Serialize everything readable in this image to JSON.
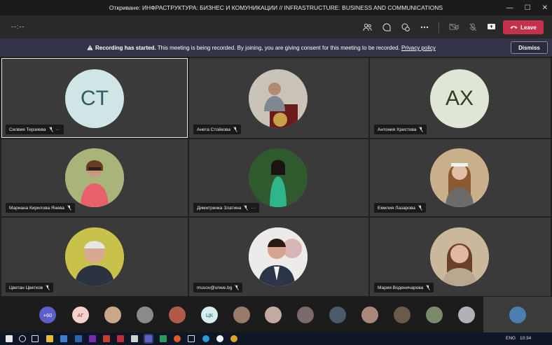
{
  "window": {
    "title": "Откриване: ИНФРАСТРУКТУРА: БИЗНЕС И КОМУНИКАЦИИ // INFRASTRUCTURE: BUSINESS AND COMMUNICATIONS"
  },
  "toolbar": {
    "timer": "--:--",
    "leave_label": "Leave"
  },
  "banner": {
    "bold": "Recording has started.",
    "text": " This meeting is being recorded. By joining, you are giving consent for this meeting to be recorded.",
    "link": "Privacy policy",
    "dismiss_label": "Dismiss"
  },
  "participants": [
    {
      "name": "Силвия Терзиева",
      "initials": "CT",
      "avatar_color": "#cfe5e6",
      "more": "···"
    },
    {
      "name": "Анета Стойкова",
      "initials": "",
      "avatar_color": "#6b5a52",
      "more": ""
    },
    {
      "name": "Антония Христова",
      "initials": "AX",
      "avatar_color": "#dfe6d6",
      "more": ""
    },
    {
      "name": "Мариана Кирилова Янева",
      "initials": "",
      "avatar_color": "#d4c9a4",
      "more": ""
    },
    {
      "name": "Димитринка Златина",
      "initials": "",
      "avatar_color": "#3f6a3a",
      "more": "···"
    },
    {
      "name": "Емилия Лазарова",
      "initials": "",
      "avatar_color": "#8c6a52",
      "more": ""
    },
    {
      "name": "Цветан Цветков",
      "initials": "",
      "avatar_color": "#c9c24a",
      "more": ""
    },
    {
      "name": "musov@unwe.bg",
      "initials": "",
      "avatar_color": "#e6e2df",
      "more": ""
    },
    {
      "name": "Мария Воденичарова",
      "initials": "",
      "avatar_color": "#b7a48b",
      "more": ""
    }
  ],
  "tray": [
    {
      "label": "+60",
      "color": "#5b5fc7",
      "text_color": "#ffffff"
    },
    {
      "label": "АГ",
      "color": "#f3d3cc",
      "text_color": "#8a3b2b"
    },
    {
      "label": "",
      "color": "#c9a88a",
      "text_color": "#000"
    },
    {
      "label": "",
      "color": "#8a8a8a",
      "text_color": "#000"
    },
    {
      "label": "",
      "color": "#b25a4a",
      "text_color": "#000"
    },
    {
      "label": "ЦК",
      "color": "#d6eef0",
      "text_color": "#1f5a60"
    },
    {
      "label": "",
      "color": "#9a7a6a",
      "text_color": "#000"
    },
    {
      "label": "",
      "color": "#c4a9a0",
      "text_color": "#000"
    },
    {
      "label": "",
      "color": "#7a6a6a",
      "text_color": "#000"
    },
    {
      "label": "",
      "color": "#4a5a6a",
      "text_color": "#000"
    },
    {
      "label": "",
      "color": "#a98a7a",
      "text_color": "#000"
    },
    {
      "label": "",
      "color": "#6a5a4a",
      "text_color": "#000"
    },
    {
      "label": "",
      "color": "#7a8a6a",
      "text_color": "#000"
    },
    {
      "label": "",
      "color": "#b0b0b8",
      "text_color": "#000"
    }
  ],
  "taskbar": {
    "lang": "ENG",
    "time": "10:34"
  }
}
